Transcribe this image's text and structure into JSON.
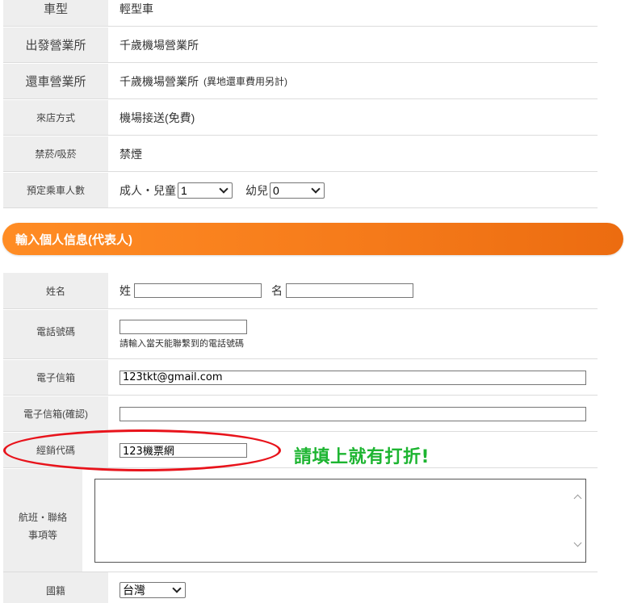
{
  "rental": {
    "car_type": {
      "label": "車型",
      "value": "輕型車"
    },
    "departure": {
      "label": "出發營業所",
      "value": "千歲機場營業所"
    },
    "return": {
      "label": "還車營業所",
      "value": "千歲機場營業所",
      "note": "(異地還車費用另計)"
    },
    "arrival": {
      "label": "來店方式",
      "value": "機場接送(免費)"
    },
    "smoking": {
      "label": "禁菸/吸菸",
      "value": "禁煙"
    },
    "passengers": {
      "label": "預定乘車人數",
      "adult_label": "成人・兒童",
      "adult_value": "1",
      "infant_label": "幼兒",
      "infant_value": "0"
    }
  },
  "section": {
    "title": "輸入個人信息(代表人)"
  },
  "form": {
    "name": {
      "label": "姓名",
      "surname_label": "姓",
      "given_label": "名",
      "surname_value": "",
      "given_value": ""
    },
    "phone": {
      "label": "電話號碼",
      "value": "",
      "hint": "請輸入當天能聯繫到的電話號碼"
    },
    "email": {
      "label": "電子信箱",
      "value": "123tkt@gmail.com"
    },
    "email_confirm": {
      "label": "電子信箱(確認)",
      "value": ""
    },
    "agent_code": {
      "label": "經銷代碼",
      "value": "123機票網"
    },
    "flight": {
      "label_line1": "航班・聯絡",
      "label_line2": "事項等",
      "value": ""
    },
    "nationality": {
      "label": "國籍",
      "value": "台灣"
    }
  },
  "annotation": {
    "text": "請填上就有打折!",
    "color": "#1db531",
    "circle_color": "#e8131b"
  },
  "colors": {
    "banner": "#f57a1a",
    "label_bg": "#eeeeee"
  }
}
